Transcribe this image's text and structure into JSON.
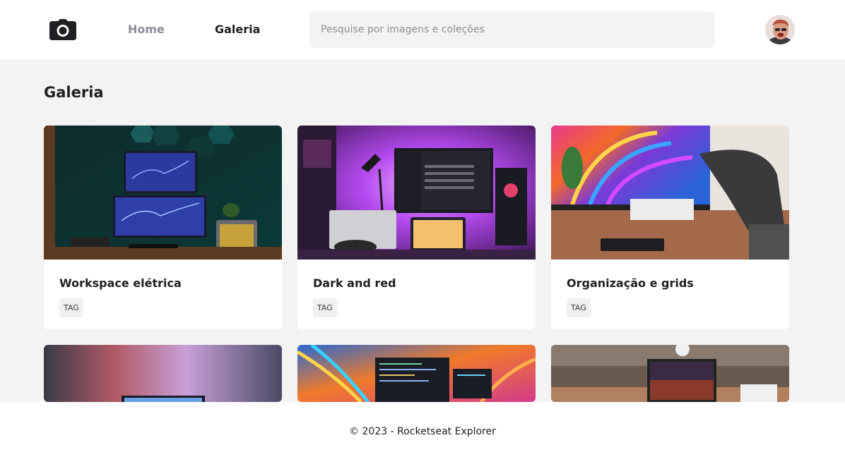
{
  "header": {
    "logo_icon": "camera-icon",
    "nav": [
      {
        "label": "Home",
        "active": false
      },
      {
        "label": "Galeria",
        "active": true
      }
    ],
    "search": {
      "value": "",
      "placeholder": "Pesquise por imagens e coleções"
    },
    "avatar_icon": "user-avatar"
  },
  "main": {
    "title": "Galeria",
    "cards": [
      {
        "title": "Workspace elétrica",
        "tag": "TAG",
        "image": "dual-monitor-teal-workspace-photo"
      },
      {
        "title": "Dark and red",
        "tag": "TAG",
        "image": "purple-lit-desk-setup-photo"
      },
      {
        "title": "Organização e grids",
        "tag": "TAG",
        "image": "colorful-wallpaper-desk-photo"
      },
      {
        "title": "",
        "tag": "",
        "image": "blurred-gradient-laptop-photo"
      },
      {
        "title": "",
        "tag": "",
        "image": "code-editor-orange-wallpaper-photo"
      },
      {
        "title": "",
        "tag": "",
        "image": "laptop-warm-desk-photo"
      }
    ]
  },
  "footer": {
    "text": "© 2023 - Rocketseat Explorer"
  },
  "colors": {
    "text": "#1f1f24",
    "muted": "#8d8d99",
    "background": "#f3f3f3",
    "surface": "#ffffff"
  }
}
